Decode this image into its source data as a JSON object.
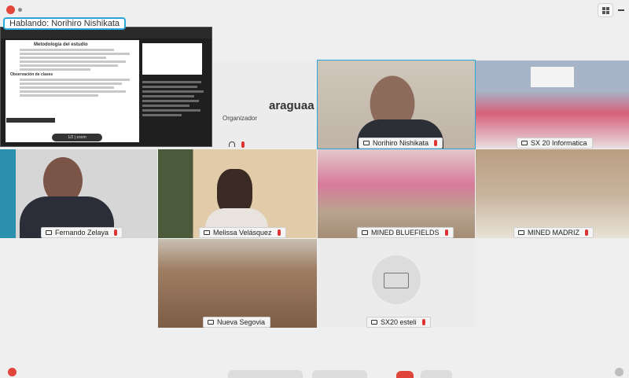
{
  "speaking": "Hablando: Norihiro Nishikata",
  "organizer": {
    "name": "araguaa Sede",
    "role": "Organizador"
  },
  "presentation": {
    "page_title": "Metodología del estudio",
    "section": "Observación de clases",
    "page_indicator": "1/2 | zoom"
  },
  "participants": [
    {
      "name": "Norihiro Nishikata"
    },
    {
      "name": "SX 20 Informatica"
    },
    {
      "name": "Fernando Zelaya"
    },
    {
      "name": "Melissa Velásquez"
    },
    {
      "name": "MINED BLUEFIELDS"
    },
    {
      "name": "MINED MADRIZ"
    },
    {
      "name": "Nueva Segovia"
    },
    {
      "name": "SX20 esteli"
    }
  ],
  "colors": {
    "active_border": "#2aa6d8",
    "muted_mic": "#d33",
    "end_call": "#e0453a"
  }
}
